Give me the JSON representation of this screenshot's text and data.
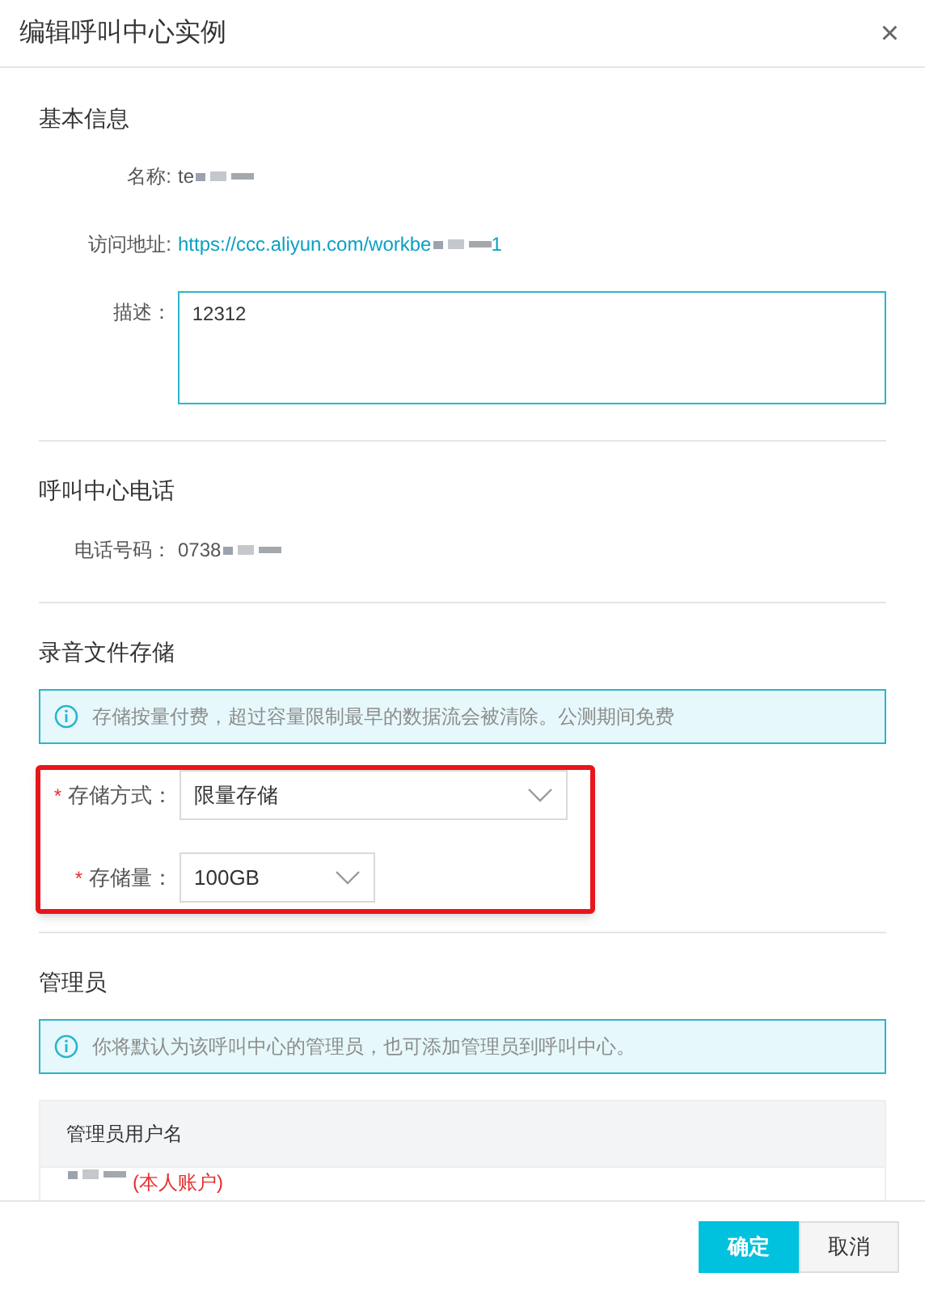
{
  "dialog": {
    "title": "编辑呼叫中心实例",
    "close": "×"
  },
  "basic": {
    "title": "基本信息",
    "rows": [
      {
        "kind": "text",
        "label": "名称:",
        "value": "te",
        "redacted": true
      },
      {
        "kind": "link",
        "label": "访问地址:",
        "value": "https://ccc.aliyun.com/workbe",
        "redacted": true,
        "tail": "1"
      },
      {
        "kind": "textarea",
        "label": "描述：",
        "value": "12312"
      }
    ]
  },
  "phone": {
    "title": "呼叫中心电话",
    "label": "电话号码：",
    "value": "0738",
    "redacted": true
  },
  "storage": {
    "title": "录音文件存储",
    "notice": "存储按量付费，超过容量限制最早的数据流会被清除。公测期间免费",
    "highlighted": true,
    "fields": [
      {
        "kind": "wide",
        "label": "存储方式：",
        "value": "限量存储",
        "required_mark": "*"
      },
      {
        "kind": "narrow",
        "label": "存储量：",
        "value": "100GB",
        "required_mark": "*"
      }
    ]
  },
  "admins": {
    "title": "管理员",
    "notice": "你将默认为该呼叫中心的管理员，也可添加管理员到呼叫中心。",
    "columns": [
      "管理员用户名"
    ],
    "rows": [
      {
        "redacted": true,
        "tag": "(本人账户)"
      }
    ]
  },
  "buttons": [
    {
      "label": "确定",
      "primary": true
    },
    {
      "label": "取消",
      "primary": false
    }
  ]
}
